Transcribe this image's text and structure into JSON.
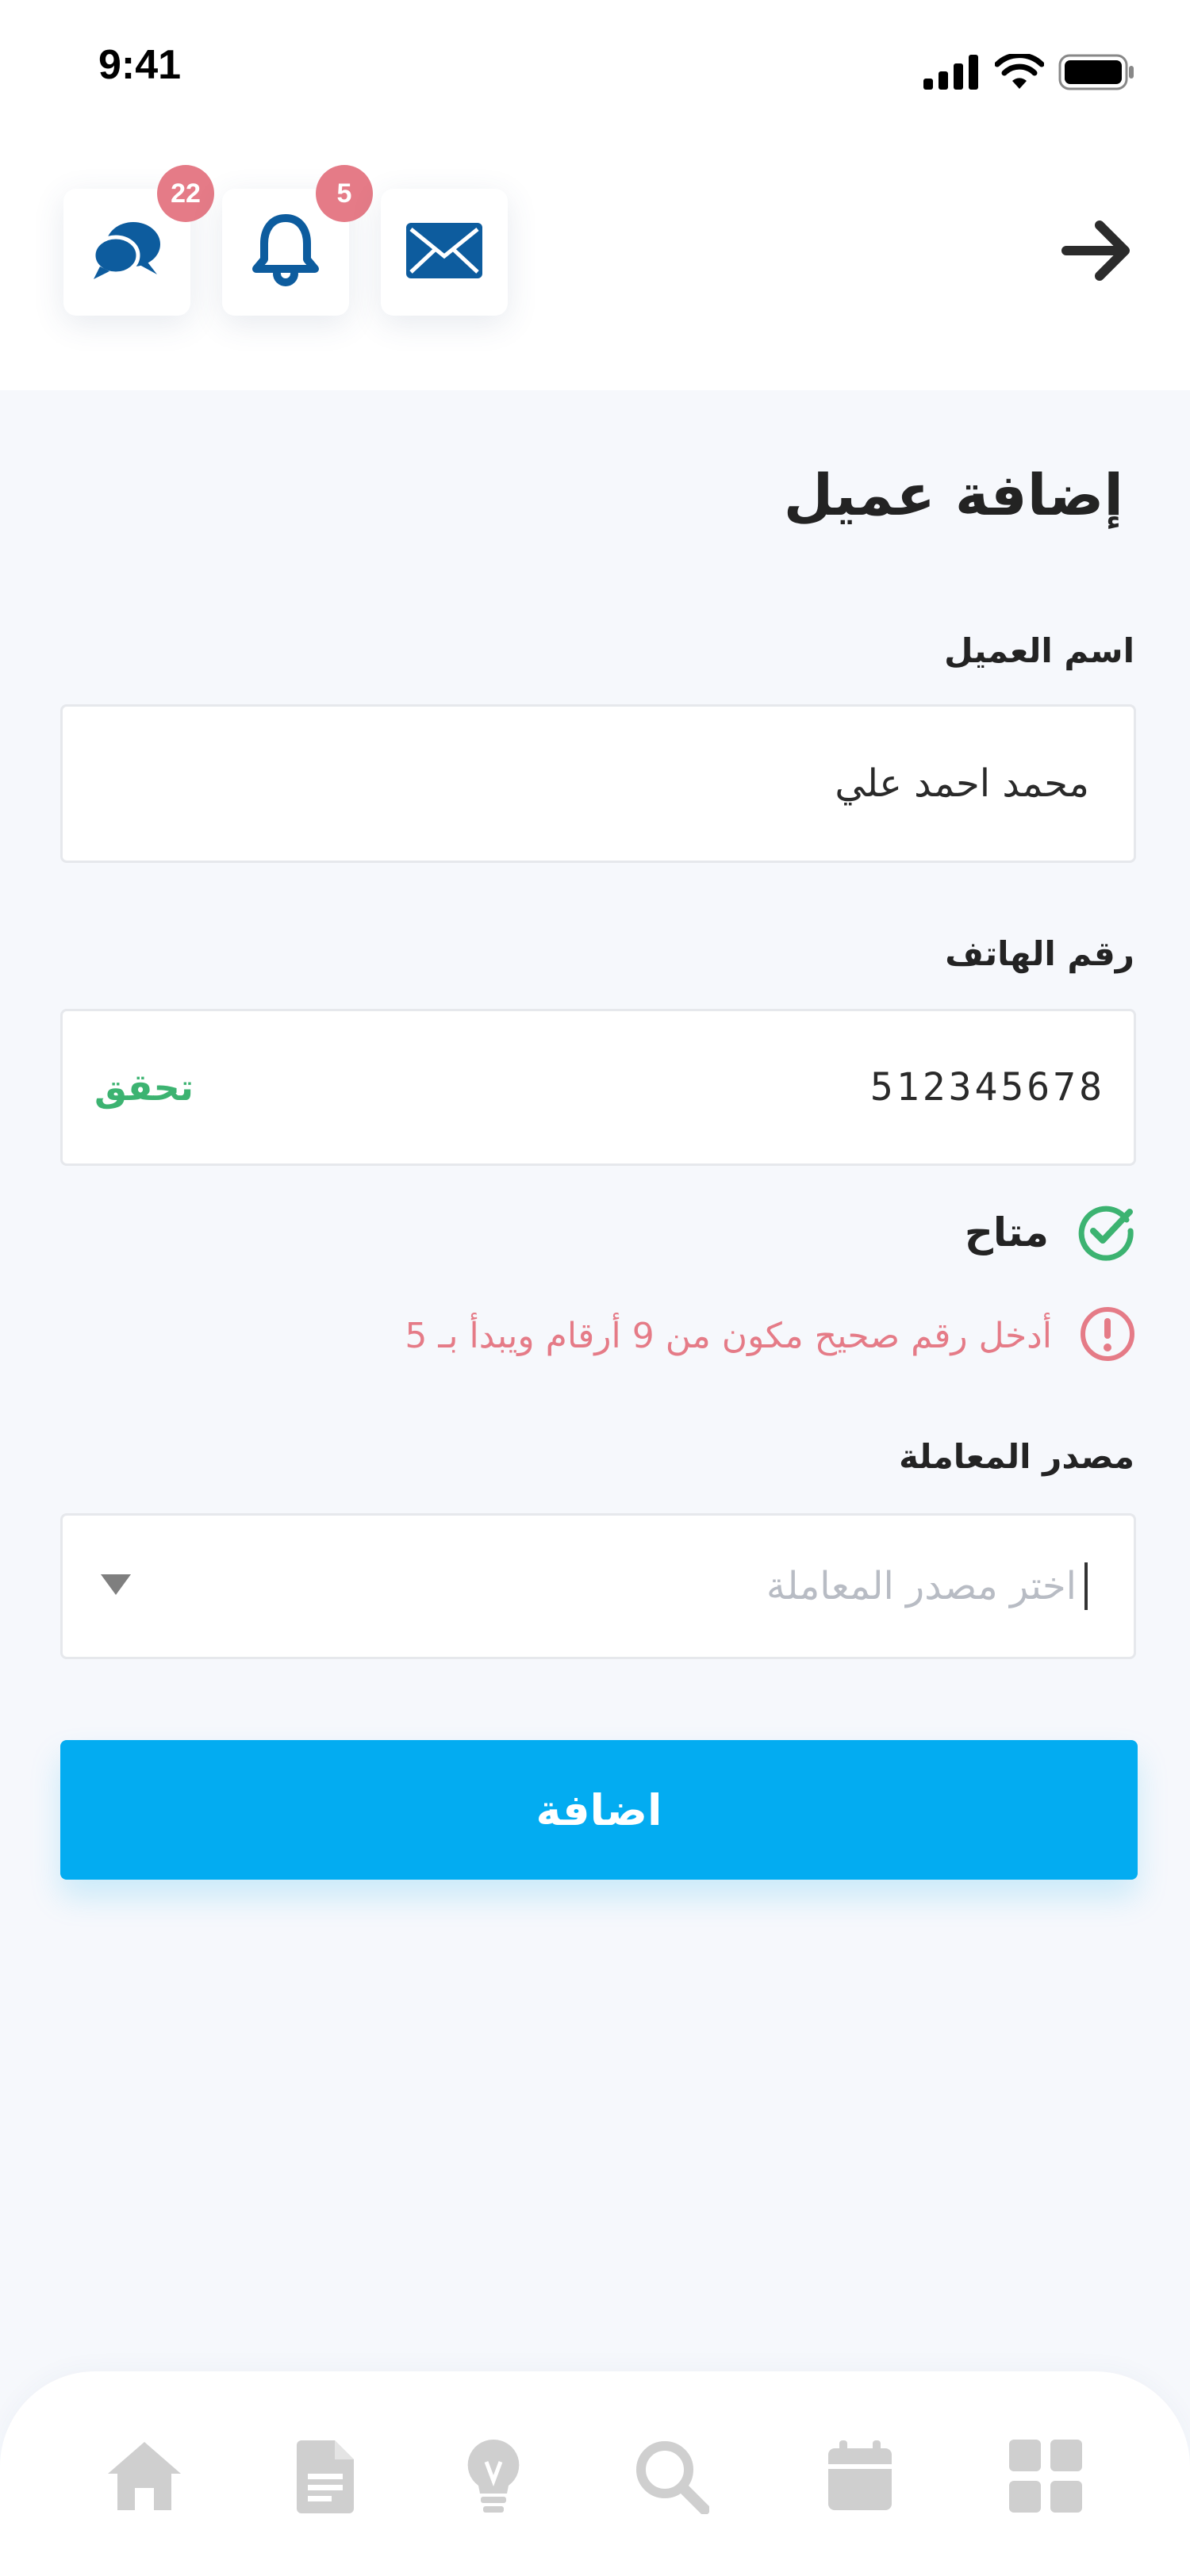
{
  "status_bar": {
    "time": "9:41"
  },
  "header": {
    "messages_badge": "22",
    "notifications_badge": "5"
  },
  "form": {
    "title": "إضافة عميل",
    "customer_name": {
      "label": "اسم العميل",
      "value": "محمد احمد علي"
    },
    "phone": {
      "label": "رقم الهاتف",
      "value": "512345678",
      "verify_label": "تحقق"
    },
    "available_text": "متاح",
    "error_text": "أدخل رقم صحيح مكون من 9 أرقام ويبدأ بـ 5",
    "source": {
      "label": "مصدر المعاملة",
      "placeholder": "اختر مصدر المعاملة"
    },
    "submit_label": "اضافة"
  },
  "colors": {
    "accent": "#03ACF1",
    "icon_blue": "#0D5C9E",
    "success": "#3CB371",
    "error": "#E57B87",
    "badge": "#E57B87",
    "nav_icon": "#CFCFCF"
  },
  "bottom_nav": {
    "items": [
      "home-icon",
      "document-icon",
      "lightbulb-icon",
      "search-icon",
      "calendar-icon",
      "grid-icon"
    ]
  }
}
